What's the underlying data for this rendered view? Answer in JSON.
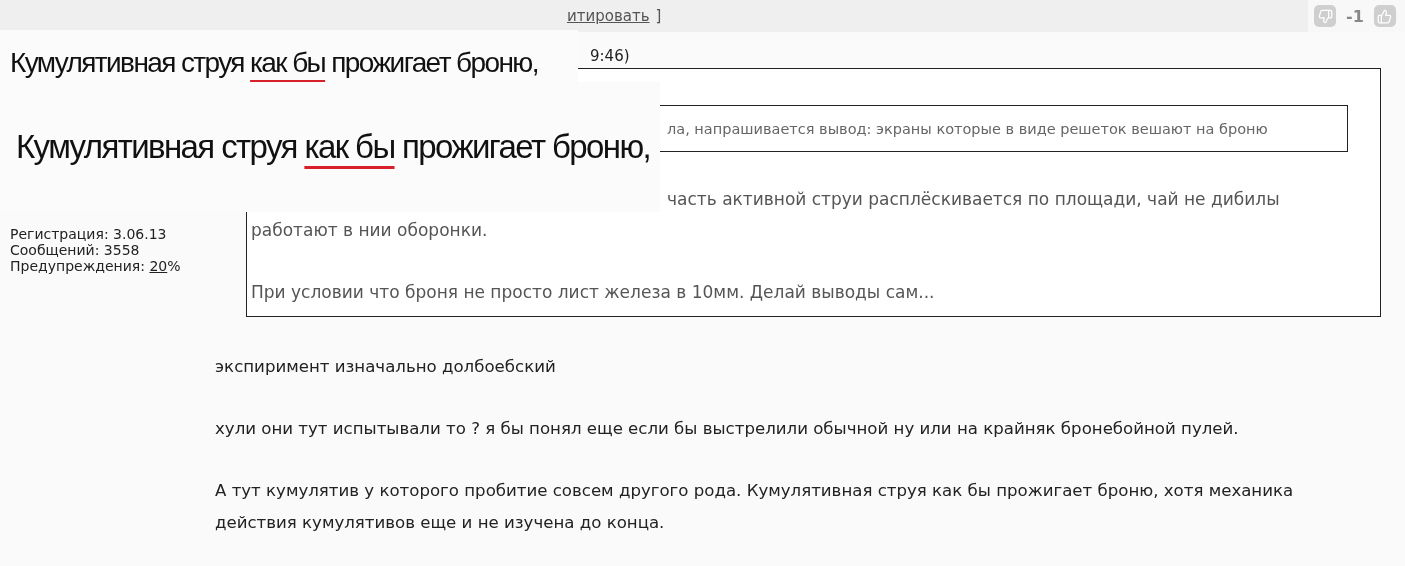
{
  "top_bar": {
    "link": "итировать",
    "bracket": "]",
    "vote": {
      "score": "-1"
    }
  },
  "user_info": [
    "Регистрация: 3.06.13",
    "Сообщений: 3558",
    "Предупреждения: **20**%"
  ],
  "date_fragment": "9:46)",
  "quote": {
    "inner_quote": "ла, напрашивается вывод: экраны которые в виде решеток вешают на броню",
    "first_line_fragment": "часть активной струи расплёскивается по площади, чай не дибилы",
    "paragraphs": [
      "работают в нии оборонки.",
      "При условии что броня не просто лист железа в 10мм. Делай выводы сам..."
    ]
  },
  "post_paragraphs": [
    "экспиримент изначально долбоебский",
    "хули они тут испытывали то ? я бы понял еще если бы выстрелили обычной ну или на крайняк бронебойной пулей.",
    "А тут кумулятив у которого пробитие совсем другого рода. Кумулятивная струя как бы прожигает броню, хотя механика действия кумулятивов еще и не изучена до конца."
  ],
  "overlay_snippets": [
    "Кумулятивная струя *как бы* прожигает броню,",
    "Кумулятивная струя *как бы* прожигает броню,"
  ]
}
